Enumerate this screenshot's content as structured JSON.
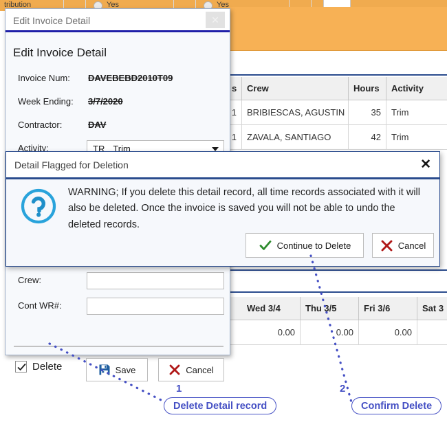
{
  "background": {
    "top_strip": {
      "label": "tribution",
      "radio_labels": [
        "Yes",
        "Yes"
      ]
    },
    "grid_top": {
      "columns": [
        "s",
        "Crew",
        "Hours",
        "Activity"
      ],
      "rows": [
        [
          "1",
          "BRIBIESCAS, AGUSTIN",
          "35",
          "Trim"
        ],
        [
          "1",
          "ZAVALA, SANTIAGO",
          "42",
          "Trim"
        ]
      ]
    },
    "grid_bottom": {
      "columns": [
        "Wed 3/4",
        "Thu 3/5",
        "Fri 3/6",
        "Sat 3"
      ],
      "rows": [
        [
          "0.00",
          "0.00",
          "0.00",
          ""
        ]
      ]
    }
  },
  "edit_window": {
    "titlebar_title": "Edit Invoice Detail",
    "close_icon": "close-icon",
    "heading": "Edit Invoice Detail",
    "fields": [
      {
        "label": "Invoice Num:",
        "value": "DAVEBEBD2010T09",
        "type": "strikethrough-text"
      },
      {
        "label": "Week Ending:",
        "value": "3/7/2020",
        "type": "strikethrough-text"
      },
      {
        "label": "Contractor:",
        "value": "DAV",
        "type": "strikethrough-text"
      },
      {
        "label": "Activity:",
        "value_code": "TR",
        "value_desc": "Trim",
        "type": "combobox"
      },
      {
        "label": "Crew:",
        "value": "",
        "type": "textbox"
      },
      {
        "label": "Cont WR#:",
        "value": "",
        "type": "textbox"
      }
    ],
    "delete_checkbox": {
      "label": "Delete",
      "checked": true
    },
    "save_label": "Save",
    "cancel_label": "Cancel",
    "save_icon": "floppy-disk-save-icon",
    "cancel_icon": "red-x-icon"
  },
  "warning_dialog": {
    "title": "Detail Flagged for Deletion",
    "close_icon": "close-x-icon",
    "icon": "question-mark-circle-icon",
    "message": "WARNING;  If you delete this detail record, all time records associated with it will also be deleted.  Once the invoice is saved you will not be able to undo the deleted records.",
    "continue_label": "Continue to Delete",
    "continue_icon": "green-check-icon",
    "cancel_label": "Cancel",
    "cancel_icon": "red-x-icon"
  },
  "annotations": [
    {
      "number": "1",
      "label": "Delete Detail record"
    },
    {
      "number": "2",
      "label": "Confirm Delete"
    }
  ],
  "colors": {
    "orange_header": "#f7b155",
    "accent_blue": "#2a4b8d",
    "annotation_purple": "#4550c4",
    "title_underline": "#1f1fa8"
  }
}
